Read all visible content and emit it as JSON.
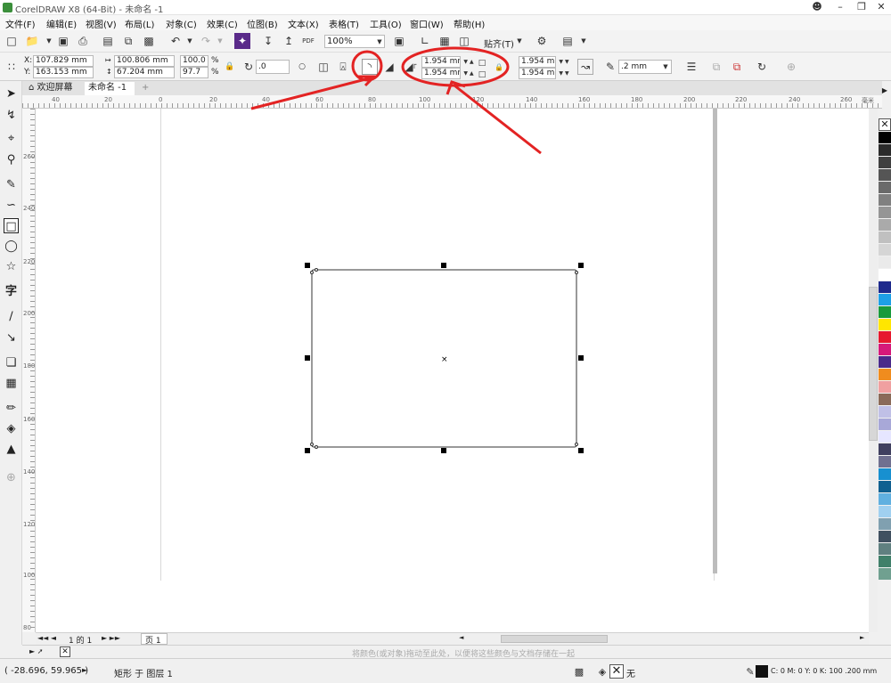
{
  "window": {
    "title": "CorelDRAW X8 (64-Bit) - 未命名 -1"
  },
  "menu": [
    "文件(F)",
    "编辑(E)",
    "视图(V)",
    "布局(L)",
    "对象(C)",
    "效果(C)",
    "位图(B)",
    "文本(X)",
    "表格(T)",
    "工具(O)",
    "窗口(W)",
    "帮助(H)"
  ],
  "toolbar": {
    "zoom": "100%",
    "snap_label": "贴齐(T)",
    "pdf_label": "PDF"
  },
  "propbar": {
    "x": "107.829 mm",
    "y": "163.153 mm",
    "x_label": "X:",
    "y_label": "Y:",
    "width": "100.806 mm",
    "height": "67.204 mm",
    "scale_w": "100.0",
    "scale_h": "97.7",
    "percent": "%",
    "rotation": ".0",
    "corner_tl": "1.954 mm",
    "corner_bl": "1.954 mm",
    "corner_tr": "1.954 mm",
    "corner_br": "1.954 mm",
    "outline_width": ".2 mm"
  },
  "tabs": [
    "欢迎屏幕",
    "未命名 -1"
  ],
  "ruler": {
    "h_ticks": [
      "40",
      "20",
      "0",
      "20",
      "40",
      "60",
      "80",
      "100",
      "120",
      "140",
      "160",
      "180",
      "200",
      "220",
      "240",
      "260"
    ],
    "h_unit": "毫米",
    "v_ticks": [
      "260",
      "240",
      "220",
      "200",
      "180",
      "160",
      "140",
      "120",
      "100",
      "80"
    ]
  },
  "page_nav": {
    "counter": "1 的 1",
    "page_tab": "页 1"
  },
  "colorbar_hint": "将颜色(或对象)拖动至此处，以便将这些颜色与文档存储在一起",
  "status": {
    "cursor": "( -28.696, 59.965 )",
    "selection": "矩形 于 图层 1",
    "fill": "无",
    "outline": "C: 0 M: 0 Y: 0 K: 100  .200 mm"
  },
  "palette_colors": [
    "#000000",
    "#2b2b2b",
    "#404040",
    "#555555",
    "#6a6a6a",
    "#808080",
    "#959595",
    "#aaaaaa",
    "#c0c0c0",
    "#d5d5d5",
    "#eaeaea",
    "#ffffff",
    "#1e2a8c",
    "#1ea0e6",
    "#1a9a3c",
    "#ffe600",
    "#e6192e",
    "#d6197a",
    "#4a2a8a",
    "#f08c1e",
    "#f0a0a0",
    "#8a6a58",
    "#c0c0e6",
    "#a8a8d8",
    "#e6e6ff",
    "#404060",
    "#707090",
    "#1890d0",
    "#106090",
    "#60b0e0",
    "#a0d0f0",
    "#80a0b0",
    "#405060",
    "#608080",
    "#40806a",
    "#70a090"
  ],
  "canvas": {
    "page_border_color": "#d9d9d9"
  }
}
